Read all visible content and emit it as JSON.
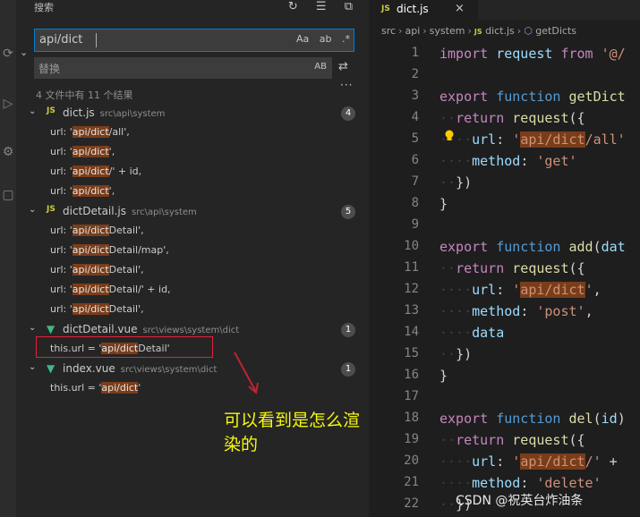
{
  "sidebar": {
    "title": "搜索",
    "search": {
      "value": "api/dict",
      "options": [
        "Aa",
        "ab",
        ".*"
      ]
    },
    "replace": {
      "placeholder": "替换",
      "preserve_case": "AB"
    },
    "summary": "4 文件中有 11 个结果",
    "files": [
      {
        "icon": "JS",
        "name": "dict.js",
        "path": "src\\api\\system",
        "count": "4",
        "matches": [
          {
            "pre": "url: '",
            "hit": "api/dict",
            "post": "/all',"
          },
          {
            "pre": "url: '",
            "hit": "api/dict",
            "post": "',"
          },
          {
            "pre": "url: '",
            "hit": "api/dict",
            "post": "/' + id,"
          },
          {
            "pre": "url: '",
            "hit": "api/dict",
            "post": "',"
          }
        ]
      },
      {
        "icon": "JS",
        "name": "dictDetail.js",
        "path": "src\\api\\system",
        "count": "5",
        "matches": [
          {
            "pre": "url: '",
            "hit": "api/dict",
            "post": "Detail',"
          },
          {
            "pre": "url: '",
            "hit": "api/dict",
            "post": "Detail/map',"
          },
          {
            "pre": "url: '",
            "hit": "api/dict",
            "post": "Detail',"
          },
          {
            "pre": "url: '",
            "hit": "api/dict",
            "post": "Detail/' + id,"
          },
          {
            "pre": "url: '",
            "hit": "api/dict",
            "post": "Detail',"
          }
        ]
      },
      {
        "icon": "▼",
        "name": "dictDetail.vue",
        "path": "src\\views\\system\\dict",
        "count": "1",
        "matches": [
          {
            "pre": "this.url = '",
            "hit": "api/dict",
            "post": "Detail'"
          }
        ]
      },
      {
        "icon": "▼",
        "name": "index.vue",
        "path": "src\\views\\system\\dict",
        "count": "1",
        "matches": [
          {
            "pre": "this.url = '",
            "hit": "api/dict",
            "post": "'"
          }
        ]
      }
    ]
  },
  "annotation": "可以看到是怎么渲染的",
  "editor": {
    "tab": {
      "icon": "JS",
      "name": "dict.js",
      "close": "×"
    },
    "breadcrumb": {
      "parts": [
        "src",
        "api",
        "system"
      ],
      "file": "dict.js",
      "symbol": "getDicts"
    },
    "lines": [
      {
        "n": "1",
        "html": "<span class='kw2'>import</span> <span class='prop'>request</span> <span class='kw2'>from</span> <span class='str'>'@/</span>"
      },
      {
        "n": "2",
        "html": ""
      },
      {
        "n": "3",
        "html": "<span class='kw2'>export</span> <span class='kw'>function</span> <span class='fnc'>getDict</span>"
      },
      {
        "n": "4",
        "html": "<span class='dots'>··</span><span class='kw2'>return</span> <span class='fnc'>request</span>({"
      },
      {
        "n": "5",
        "html": "<span class='dots'>····</span><span class='prop'>url</span>: <span class='str'>'<span class=\"shl\">api/dict</span>/all'</span>"
      },
      {
        "n": "6",
        "html": "<span class='dots'>····</span><span class='prop'>method</span>: <span class='str'>'get'</span>"
      },
      {
        "n": "7",
        "html": "<span class='dots'>··</span>})"
      },
      {
        "n": "8",
        "html": "}"
      },
      {
        "n": "9",
        "html": ""
      },
      {
        "n": "10",
        "html": "<span class='kw2'>export</span> <span class='kw'>function</span> <span class='fnc'>add</span>(<span class='prop'>dat</span>"
      },
      {
        "n": "11",
        "html": "<span class='dots'>··</span><span class='kw2'>return</span> <span class='fnc'>request</span>({"
      },
      {
        "n": "12",
        "html": "<span class='dots'>····</span><span class='prop'>url</span>: <span class='str'>'<span class=\"shl\">api/dict</span>'</span>,"
      },
      {
        "n": "13",
        "html": "<span class='dots'>····</span><span class='prop'>method</span>: <span class='str'>'post'</span>,"
      },
      {
        "n": "14",
        "html": "<span class='dots'>····</span><span class='prop'>data</span>"
      },
      {
        "n": "15",
        "html": "<span class='dots'>··</span>})"
      },
      {
        "n": "16",
        "html": "}"
      },
      {
        "n": "17",
        "html": ""
      },
      {
        "n": "18",
        "html": "<span class='kw2'>export</span> <span class='kw'>function</span> <span class='fnc'>del</span>(<span class='prop'>id</span>)"
      },
      {
        "n": "19",
        "html": "<span class='dots'>··</span><span class='kw2'>return</span> <span class='fnc'>request</span>({"
      },
      {
        "n": "20",
        "html": "<span class='dots'>····</span><span class='prop'>url</span>: <span class='str'>'<span class=\"shl\">api/dict</span>/'</span> +"
      },
      {
        "n": "21",
        "html": "<span class='dots'>····</span><span class='prop'>method</span>: <span class='str'>'delete'</span>"
      },
      {
        "n": "22",
        "html": "<span class='dots'>··</span>})"
      }
    ]
  },
  "watermark": "CSDN @祝英台炸油条"
}
